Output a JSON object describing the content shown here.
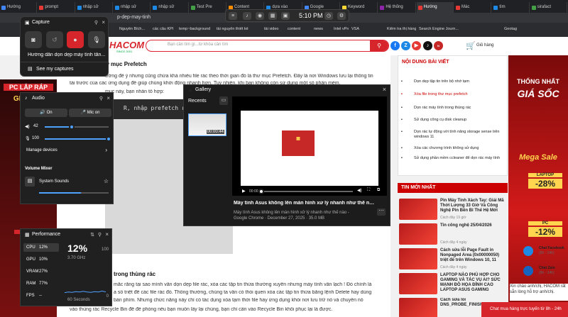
{
  "browser": {
    "tabs": [
      {
        "label": "Hướng"
      },
      {
        "label": "prompt"
      },
      {
        "label": "nhập sử"
      },
      {
        "label": "nhập sử"
      },
      {
        "label": "nhập sử"
      },
      {
        "label": "Test Pre"
      },
      {
        "label": "Content"
      },
      {
        "label": "dựa vào"
      },
      {
        "label": "Google"
      },
      {
        "label": "Keyword"
      },
      {
        "label": "Hệ thống"
      },
      {
        "label": "Hướng"
      },
      {
        "label": "Mác"
      },
      {
        "label": "tìm"
      },
      {
        "label": "sirafact"
      }
    ],
    "url": "p-dep-may-tinh",
    "bookmarks": [
      "Nguyễn Bích...",
      "các câu KPI",
      "temp~background",
      "tài nguyên thiết kế",
      "tài video",
      "content",
      "news",
      "Intel vPro | Logapad...",
      "VSA",
      "Kiểm tra thị hàng t...",
      "Search Engine Journ...",
      "Geotag"
    ]
  },
  "gamebar": {
    "time": "5:10 PM"
  },
  "site": {
    "logo_line1": "HACOM",
    "logo_line2": "SINCE 2001",
    "search_placeholder": "Bạn cần tìm gì...từ khóa cần tìm",
    "cart_label": "Giỏ hàng",
    "article": {
      "heading1": "ư mục Prefetch",
      "p1": "ường để ý nhưng cũng chứa khá nhiều file rác theo thời gian đó là thư mục Prefetch. Đây là nơi Windows lưu lại thông tin",
      "p2": "tải trước của các ứng dụng để giúp chúng khởi động nhanh hơn. Tuy nhiên, khi bạn không còn sử dụng một số phần mềm,",
      "p3": "mục này, bạn nhấn tổ hợp:",
      "code": "R, nhập prefetch rồi nhấ",
      "heading2": "trong thùng rác",
      "p4": "mắc rằng tại sao mình vẫn dọn dẹp file rác, xóa các tập tin thừa thường xuyên nhưng máy tính vẫn lạch ! Đó chính là",
      "p5": "a số triệt để các file rác đó. Thông thường, chúng ta vẫn có thói quen xóa các tập tin thừa bằng lệnh Delete hay dùng",
      "p6": "bàn phím. Nhưng chức năng này chỉ có tác dụng xóa tạm thời file hay ứng dụng khỏi nơi lưu trữ nó và chuyển nó",
      "p7": "vào thùng rác Recycle Bin để đề phòng nếu bạn muốn lấy lại chúng, bạn chỉ cần vào Recycle Bin khôi phục lại là được."
    },
    "toc": {
      "title": "NỘI DUNG BÀI VIẾT",
      "items": [
        "Dọn dẹp tập tin trên bộ nhớ tạm",
        "Xóa file trong thư mục prefetch",
        "Dọn rác máy tính trong thùng rác",
        "Sử dụng công cụ disk cleanup",
        "Dọn rác tự động với tính năng storage sense trên windows 11",
        "Xóa các chương trình không sử dụng",
        "Sử dụng phần mềm ccleaner để dọn rác máy tính"
      ]
    },
    "news": {
      "title": "TIN MỚI NHẤT",
      "items": [
        {
          "title": "Pin Máy Tính Xách Tay: Giải Mã Thời Lượng 33 Giờ Và Công Nghệ Pin Bền Bỉ Thế Hệ Mới",
          "date": "Cách đây 19 giờ"
        },
        {
          "title": "Tin công nghệ 25/04/2026",
          "date": "Cách đây 4 ngày"
        },
        {
          "title": "Cách sửa lỗi Page Fault in Nonpaged Area (0x00000050) triệt để trên Windows 10, 11",
          "date": "Cách đây 4 ngày"
        },
        {
          "title": "LAPTOP NÀO PHÙ HỢP CHO GAMING VÀ TÁC VỤ AI? SỨC MẠNH ĐỒ HỌA ĐỈNH CAO LAPTOP ASUS GAMING",
          "date": ""
        },
        {
          "title": "Cách sửa lỗi DNS_PROBE_FINISHED",
          "date": ""
        }
      ]
    },
    "right_banner": {
      "l1": "THỐNG NHẤT",
      "l2": "GIÁ SỐC",
      "l3": "Mega Sale",
      "l4": "LAPTOP",
      "l5": "-28%",
      "l6": "PC",
      "l7": "-12%"
    },
    "left_banner": {
      "l1": "PC LẮP RÁP",
      "l2": "GIÁ SỐC",
      "l3": "ĐẶT HOP"
    },
    "chat": {
      "facebook": "Chat Facebook",
      "facebook_time": "(8h - 24h)",
      "zalo": "Chat Zalo",
      "zalo_time": "(8h - 24h)",
      "message": "Xin chào anh/chị, HACOM rất sẵn lòng hỗ trợ anh/chị.",
      "bar": "Chat mua hàng trực tuyến từ 8h - 24h"
    }
  },
  "capture": {
    "title": "Capture",
    "label": "Hướng dẫn dọn dẹp máy tính tăn...",
    "my_captures": "See my captures"
  },
  "audio": {
    "title": "Audio",
    "on": "On",
    "mic_on": "Mic on",
    "vol1": "42",
    "vol2": "100",
    "vol1_level": 0.42,
    "vol2_level": 1.0,
    "manage_devices": "Manage devices",
    "mixer_title": "Volume Mixer",
    "system_sounds": "System Sounds"
  },
  "performance": {
    "title": "Performance",
    "big": "12%",
    "freq": "3.70 GHz",
    "max": "100",
    "zero": "0",
    "seconds": "60 Seconds",
    "rows": [
      {
        "label": "CPU",
        "value": "12%"
      },
      {
        "label": "GPU",
        "value": "10%"
      },
      {
        "label": "VRAM",
        "value": "27%"
      },
      {
        "label": "RAM",
        "value": "77%"
      },
      {
        "label": "FPS",
        "value": "--"
      }
    ],
    "graph": [
      10,
      12,
      11,
      13,
      12,
      14,
      12,
      11,
      13,
      12,
      15,
      12
    ]
  },
  "gallery": {
    "title": "Gallery",
    "recents": "Recents",
    "duration": "00:00:44",
    "video_title": "Máy tính Asus không lên màn hình xử lý nhanh như thế nào - Googl...",
    "video_subtitle": "Máy tính Asus không lên màn hình xử lý nhanh như thế nào - Google Chrome  ·  December 27, 2025  ·  35.0 MB",
    "timecode": "00:00"
  }
}
